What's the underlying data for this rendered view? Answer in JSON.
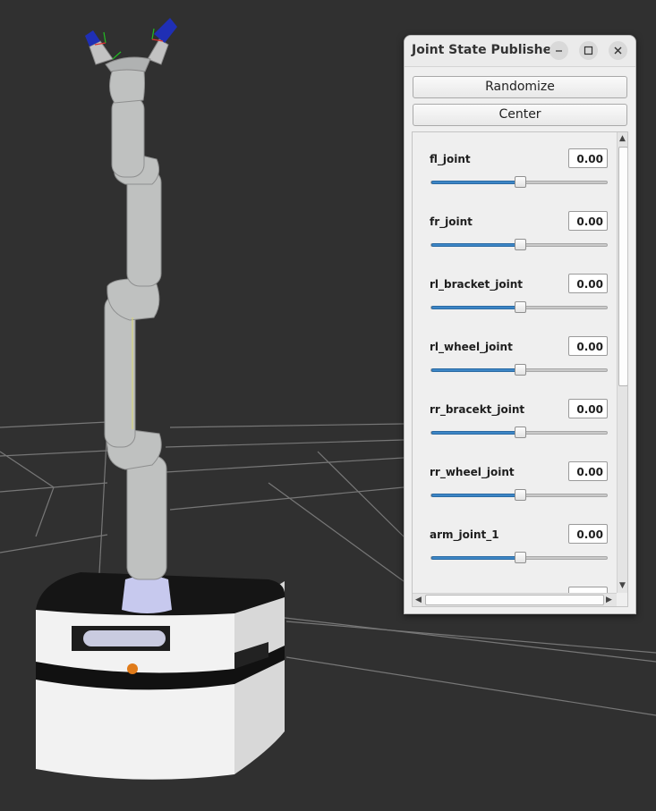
{
  "window": {
    "title": "Joint State Publisher",
    "minimize_icon": "minimize-icon",
    "maximize_icon": "maximize-icon",
    "close_icon": "close-icon"
  },
  "buttons": {
    "randomize": "Randomize",
    "center": "Center"
  },
  "joints": [
    {
      "name": "fl_joint",
      "value": "0.00",
      "slider_fraction": 0.5
    },
    {
      "name": "fr_joint",
      "value": "0.00",
      "slider_fraction": 0.5
    },
    {
      "name": "rl_bracket_joint",
      "value": "0.00",
      "slider_fraction": 0.5
    },
    {
      "name": "rl_wheel_joint",
      "value": "0.00",
      "slider_fraction": 0.5
    },
    {
      "name": "rr_bracekt_joint",
      "value": "0.00",
      "slider_fraction": 0.5
    },
    {
      "name": "rr_wheel_joint",
      "value": "0.00",
      "slider_fraction": 0.5
    },
    {
      "name": "arm_joint_1",
      "value": "0.00",
      "slider_fraction": 0.5
    }
  ],
  "colors": {
    "viewport_bg": "#303030",
    "grid": "#7a7a7a",
    "slider_fill": "#3d86c6",
    "gripper_blue": "#1f2fb5"
  }
}
